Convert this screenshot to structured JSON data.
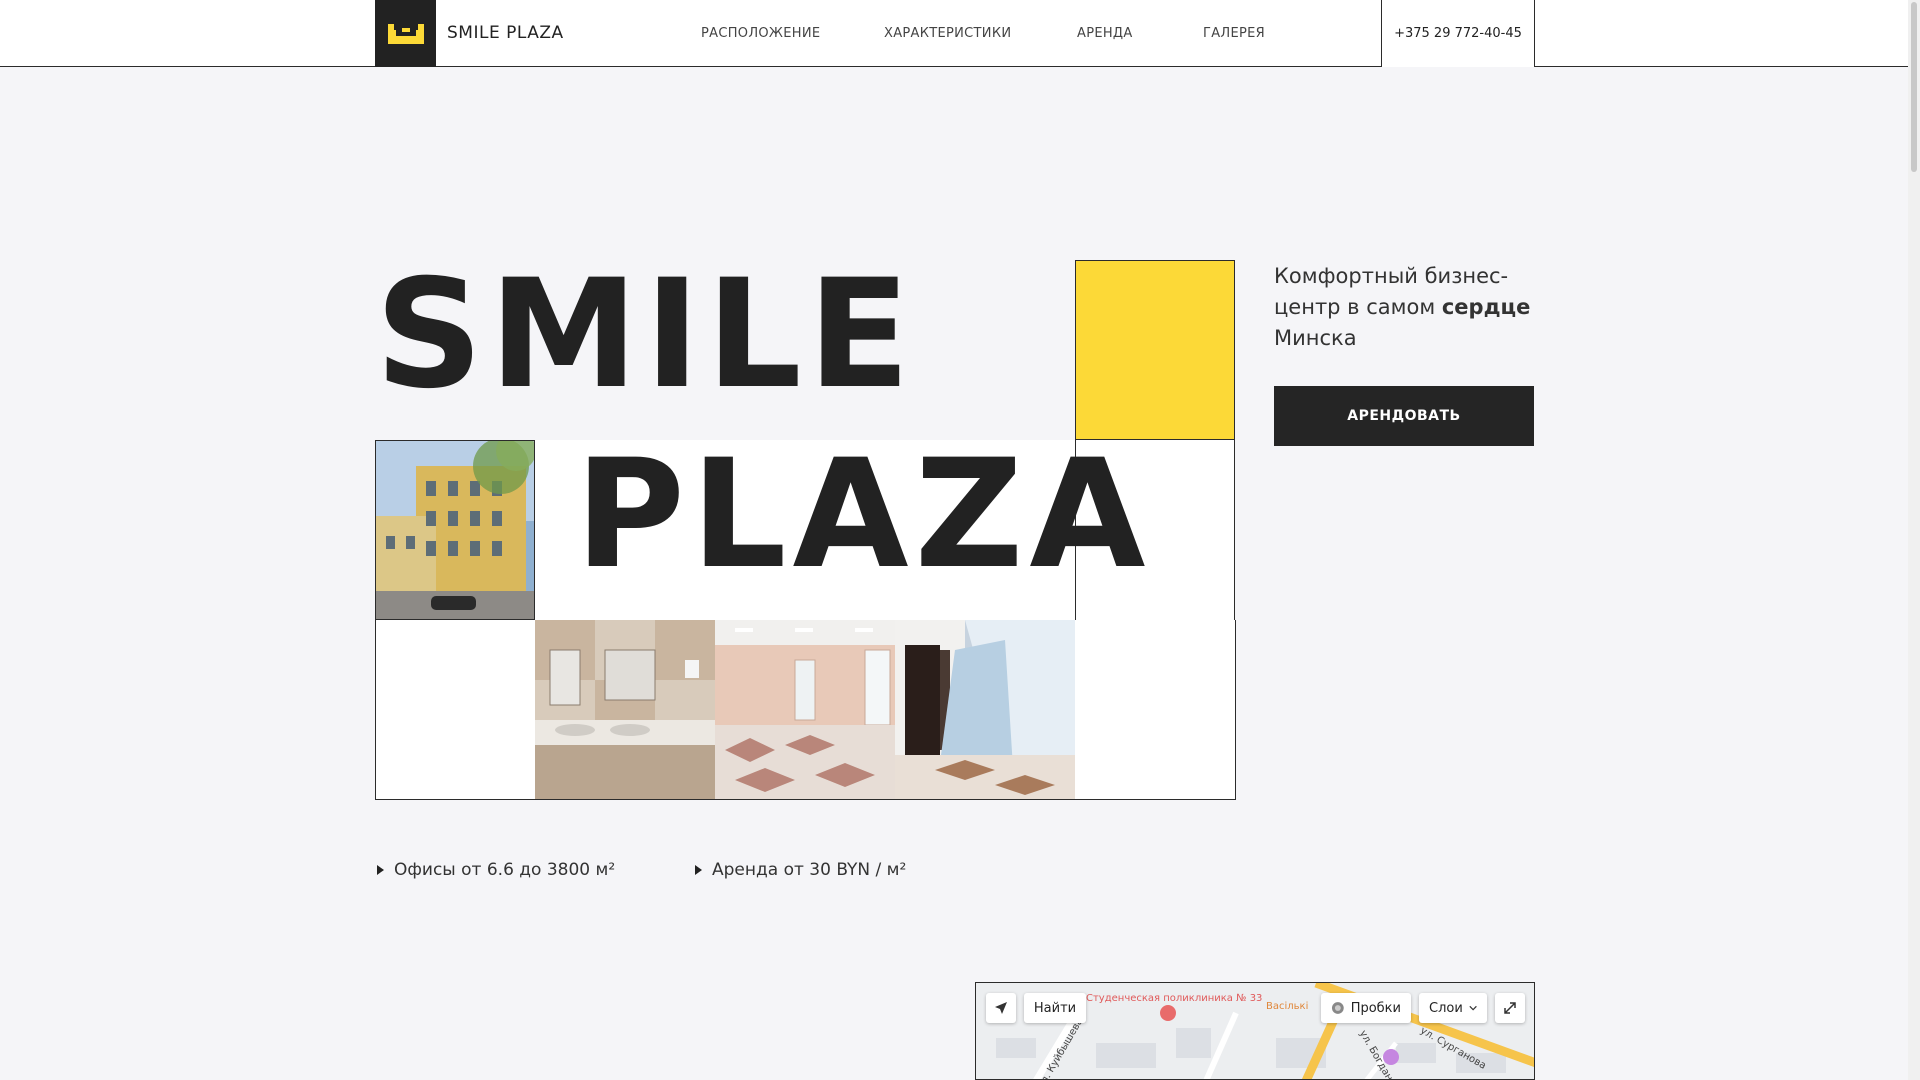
{
  "header": {
    "logo_text": "SMILE PLAZA",
    "nav": [
      "РАСПОЛОЖЕНИЕ",
      "ХАРАКТЕРИСТИКИ",
      "АРЕНДА",
      "ГАЛЕРЕЯ"
    ],
    "phone": "+375 29 772-40-45"
  },
  "hero": {
    "word1": "SMILE",
    "word2": "PLAZA",
    "tagline_pre": "Комфортный бизнес-центр в самом ",
    "tagline_bold": "сердце",
    "tagline_post": " Минска",
    "cta_label": "АРЕНДОВАТЬ"
  },
  "features": [
    {
      "text": "Офисы от 6.6 до 3800 м²"
    },
    {
      "text": "Аренда от 30 BYN / м²"
    }
  ],
  "map": {
    "find_label": "Найти",
    "traffic_label": "Пробки",
    "layers_label": "Слои",
    "labels": [
      "Студенческая поликлиника № 33",
      "Васількі",
      "ул. Сурганова",
      "ул. Богдана",
      "ул. Куйбышева"
    ]
  },
  "colors": {
    "accent": "#fcd937",
    "dark": "#222222",
    "background": "#f5f5f8"
  },
  "icons": [
    "logo-smile-icon",
    "locate-arrow-icon",
    "traffic-icon",
    "chevron-down-icon",
    "fullscreen-icon",
    "feature-arrow-icon"
  ]
}
